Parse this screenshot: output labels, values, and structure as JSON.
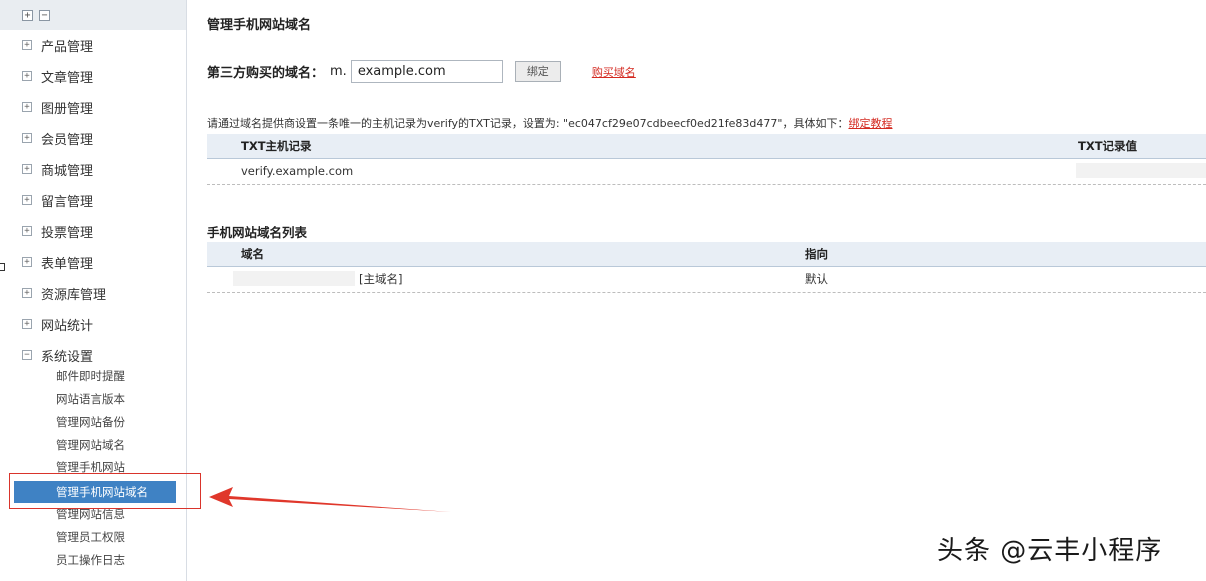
{
  "sidebar": {
    "menu": [
      {
        "label": "产品管理",
        "expand": "+"
      },
      {
        "label": "文章管理",
        "expand": "+"
      },
      {
        "label": "图册管理",
        "expand": "+"
      },
      {
        "label": "会员管理",
        "expand": "+"
      },
      {
        "label": "商城管理",
        "expand": "+"
      },
      {
        "label": "留言管理",
        "expand": "+"
      },
      {
        "label": "投票管理",
        "expand": "+"
      },
      {
        "label": "表单管理",
        "expand": "+"
      },
      {
        "label": "资源库管理",
        "expand": "+"
      },
      {
        "label": "网站统计",
        "expand": "+"
      },
      {
        "label": "系统设置",
        "expand": "−"
      }
    ],
    "submenu": [
      "邮件即时提醒",
      "网站语言版本",
      "管理网站备份",
      "管理网站域名",
      "管理手机网站"
    ],
    "active_item": "管理手机网站域名",
    "submenu_after": [
      "管理网站信息",
      "管理员工权限",
      "员工操作日志"
    ]
  },
  "main": {
    "title": "管理手机网站域名",
    "domain_label": "第三方购买的域名：",
    "prefix": "m.",
    "domain_value": "example.com",
    "bind_button": "绑定",
    "buy_link": "购买域名",
    "instruction": "请通过域名提供商设置一条唯一的主机记录为verify的TXT记录，设置为: \"ec047cf29e07cdbeecf0ed21fe83d477\"，具体如下：",
    "tutorial_link": "绑定教程",
    "txt_table": {
      "headers": [
        "TXT主机记录",
        "TXT记录值"
      ],
      "rows": [
        [
          "verify.example.com",
          ""
        ]
      ]
    },
    "list_title": "手机网站域名列表",
    "list_table": {
      "headers": [
        "域名",
        "指向"
      ],
      "rows": [
        [
          "[主域名]",
          "默认"
        ]
      ]
    }
  },
  "watermark": "头条 @云丰小程序",
  "colors": {
    "active_bg": "#3f82c4",
    "link_red": "#d42a21",
    "annotation_red": "#d9342b",
    "header_bg": "#e8eef5"
  }
}
